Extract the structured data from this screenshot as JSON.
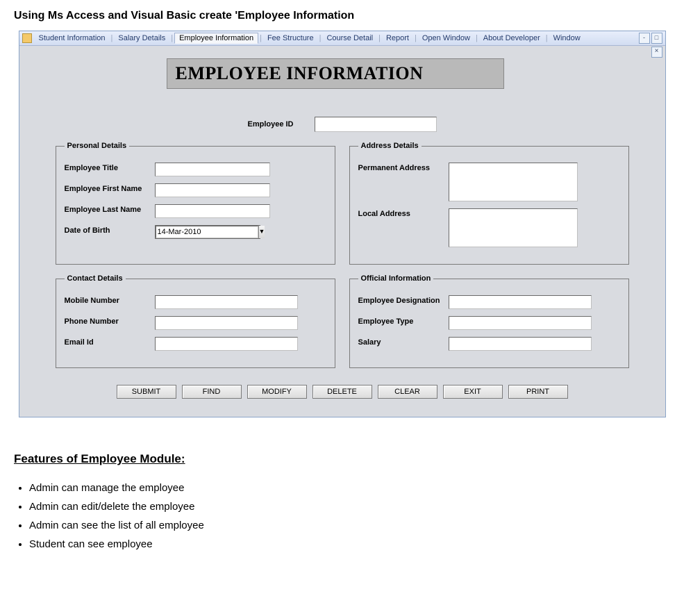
{
  "headline": "Using Ms Access and Visual Basic create 'Employee Information",
  "menu": {
    "items": [
      "Student Information",
      "Salary Details",
      "Employee Information",
      "Fee Structure",
      "Course Detail",
      "Report",
      "Open Window",
      "About Developer",
      "Window"
    ],
    "active_index": 2,
    "win_min": "-",
    "win_restore": "□",
    "win_close": "×"
  },
  "banner_title": "EMPLOYEE INFORMATION",
  "emp_id_label": "Employee ID",
  "groups": {
    "personal": {
      "legend": "Personal Details",
      "title_lbl": "Employee Title",
      "first_lbl": "Employee First Name",
      "last_lbl": "Employee Last Name",
      "dob_lbl": "Date of Birth",
      "dob_value": "14-Mar-2010"
    },
    "address": {
      "legend": "Address Details",
      "perm_lbl": "Permanent Address",
      "local_lbl": "Local Address"
    },
    "contact": {
      "legend": "Contact Details",
      "mobile_lbl": "Mobile Number",
      "phone_lbl": "Phone Number",
      "email_lbl": "Email Id"
    },
    "official": {
      "legend": "Official Information",
      "desig_lbl": "Employee Designation",
      "type_lbl": "Employee Type",
      "salary_lbl": "Salary"
    }
  },
  "buttons": {
    "submit": "SUBMIT",
    "find": "FIND",
    "modify": "MODIFY",
    "delete": "DELETE",
    "clear": "CLEAR",
    "exit": "EXIT",
    "print": "PRINT"
  },
  "features_title": "Features of Employee Module:",
  "features": [
    "Admin can manage the employee",
    "Admin can edit/delete the employee",
    "Admin can see the list of all employee",
    "Student can see employee"
  ]
}
